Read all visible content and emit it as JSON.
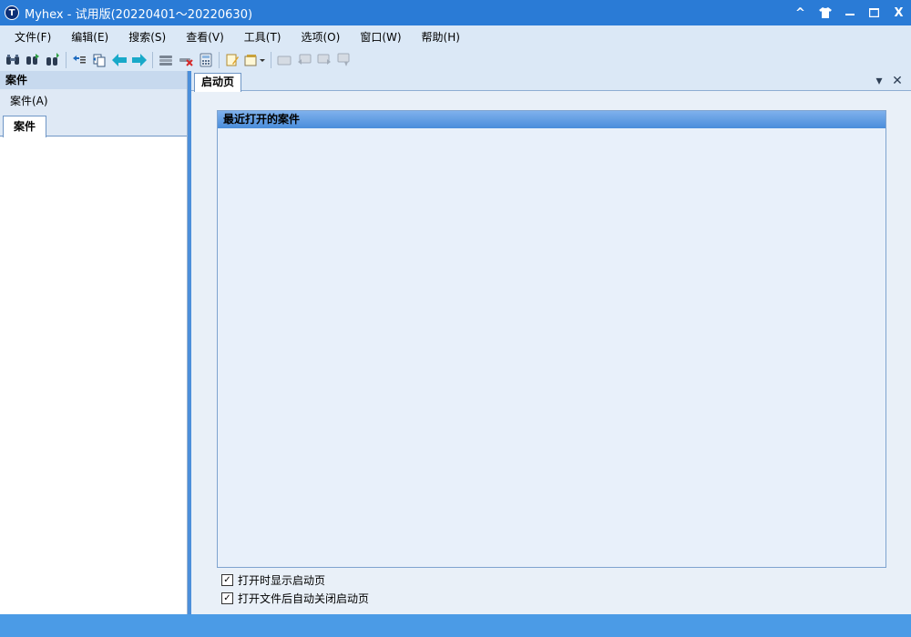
{
  "window": {
    "logo_text": "T",
    "title": "Myhex - 试用版(20220401～20220630)",
    "controls": {
      "collapse": "^",
      "skin": "👕",
      "minimize": "—",
      "maximize": "□",
      "close": "X"
    }
  },
  "menu": [
    {
      "label": "文件(F)"
    },
    {
      "label": "编辑(E)"
    },
    {
      "label": "搜索(S)"
    },
    {
      "label": "查看(V)"
    },
    {
      "label": "工具(T)"
    },
    {
      "label": "选项(O)"
    },
    {
      "label": "窗口(W)"
    },
    {
      "label": "帮助(H)"
    }
  ],
  "toolbar_icons": [
    "binoculars-icon",
    "find-next-icon",
    "find-replace-icon",
    "goto-icon",
    "copy-icon",
    "back-arrow-icon",
    "forward-arrow-icon",
    "disk-stack-icon",
    "disk-remove-icon",
    "calculator-icon",
    "edit-note-icon",
    "options-dropdown-icon",
    "bookmark-icon",
    "bookmark-prev-icon",
    "bookmark-next-icon",
    "bookmark-clear-icon"
  ],
  "left_panel": {
    "header": "案件",
    "sub_menu": "案件(A)",
    "tab": "案件"
  },
  "doc_tab": {
    "label": "启动页",
    "dropdown": "▾",
    "close": "✕"
  },
  "start_page": {
    "recent_header": "最近打开的案件",
    "options": [
      {
        "label": "打开时显示启动页",
        "checked": true
      },
      {
        "label": "打开文件后自动关闭启动页",
        "checked": true
      }
    ],
    "check_mark": "✓"
  },
  "colors": {
    "titlebar": "#2a7bd6",
    "menubar": "#dbe8f6",
    "statusbar": "#4b9be6",
    "header_gradient_top": "#7fb1ec",
    "header_gradient_bottom": "#4a8ddb"
  }
}
